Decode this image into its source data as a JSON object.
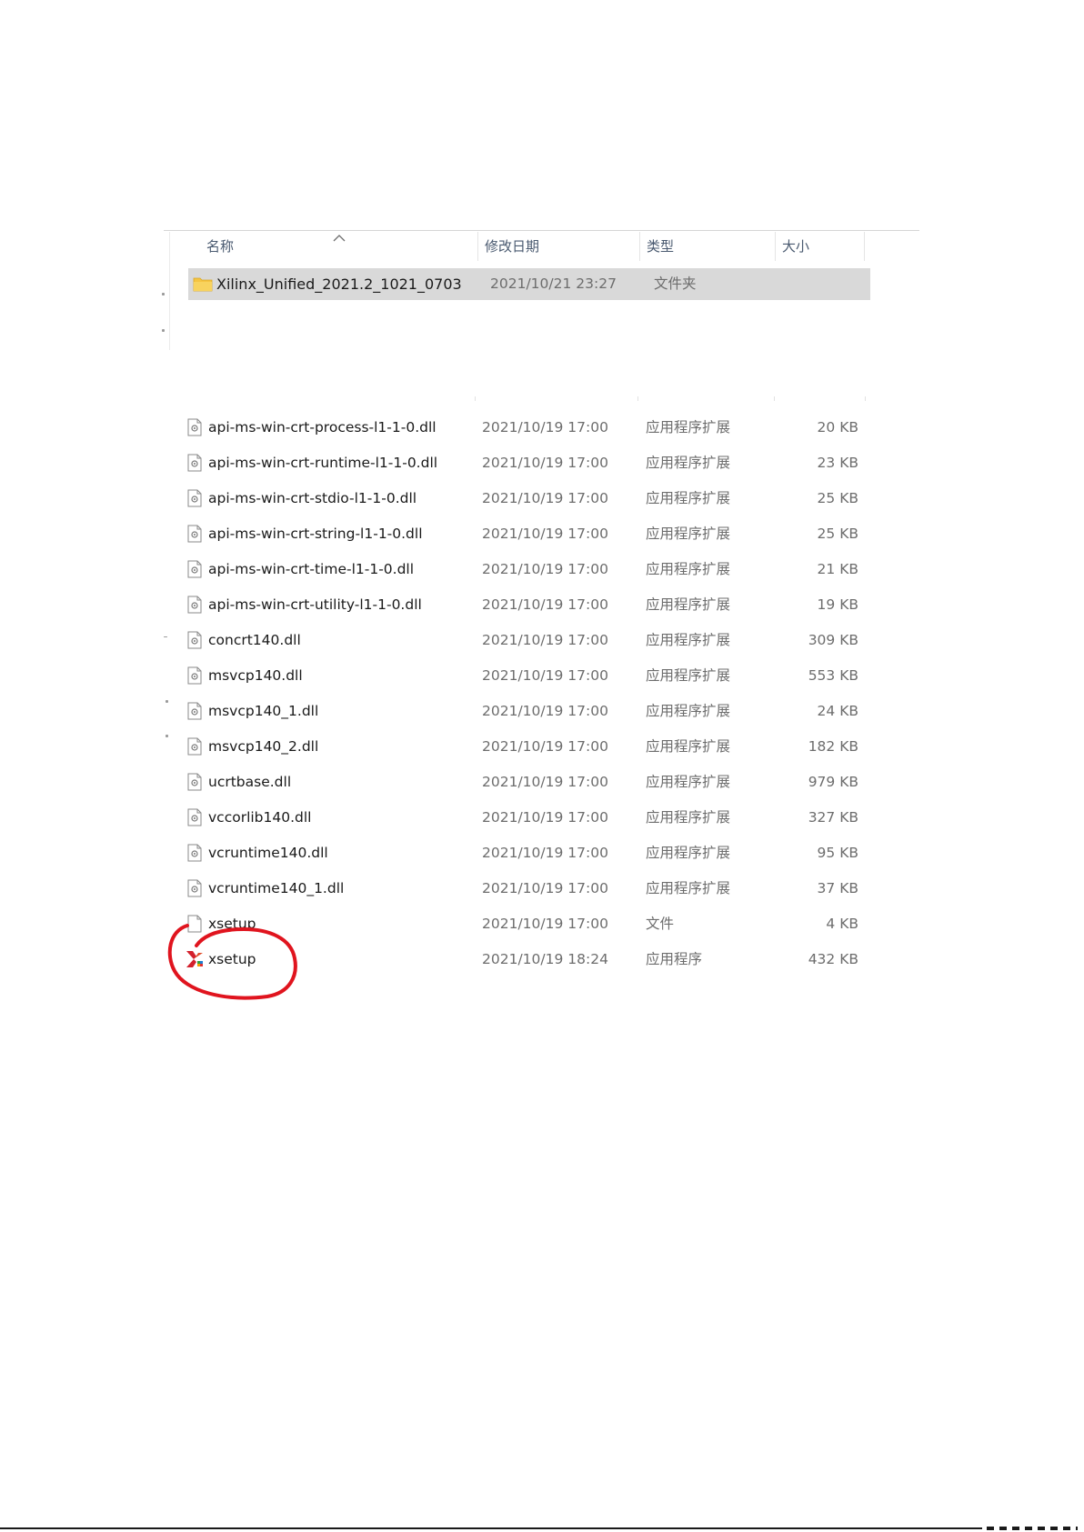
{
  "columns": {
    "name": "名称",
    "modified": "修改日期",
    "type": "类型",
    "size": "大小"
  },
  "folder": {
    "name": "Xilinx_Unified_2021.2_1021_0703",
    "modified": "2021/10/21 23:27",
    "type": "文件夹",
    "icon": "folder-icon"
  },
  "files": [
    {
      "name": "api-ms-win-crt-process-l1-1-0.dll",
      "modified": "2021/10/19 17:00",
      "type": "应用程序扩展",
      "size": "20 KB",
      "icon": "dll-file-icon"
    },
    {
      "name": "api-ms-win-crt-runtime-l1-1-0.dll",
      "modified": "2021/10/19 17:00",
      "type": "应用程序扩展",
      "size": "23 KB",
      "icon": "dll-file-icon"
    },
    {
      "name": "api-ms-win-crt-stdio-l1-1-0.dll",
      "modified": "2021/10/19 17:00",
      "type": "应用程序扩展",
      "size": "25 KB",
      "icon": "dll-file-icon"
    },
    {
      "name": "api-ms-win-crt-string-l1-1-0.dll",
      "modified": "2021/10/19 17:00",
      "type": "应用程序扩展",
      "size": "25 KB",
      "icon": "dll-file-icon"
    },
    {
      "name": "api-ms-win-crt-time-l1-1-0.dll",
      "modified": "2021/10/19 17:00",
      "type": "应用程序扩展",
      "size": "21 KB",
      "icon": "dll-file-icon"
    },
    {
      "name": "api-ms-win-crt-utility-l1-1-0.dll",
      "modified": "2021/10/19 17:00",
      "type": "应用程序扩展",
      "size": "19 KB",
      "icon": "dll-file-icon"
    },
    {
      "name": "concrt140.dll",
      "modified": "2021/10/19 17:00",
      "type": "应用程序扩展",
      "size": "309 KB",
      "icon": "dll-file-icon"
    },
    {
      "name": "msvcp140.dll",
      "modified": "2021/10/19 17:00",
      "type": "应用程序扩展",
      "size": "553 KB",
      "icon": "dll-file-icon"
    },
    {
      "name": "msvcp140_1.dll",
      "modified": "2021/10/19 17:00",
      "type": "应用程序扩展",
      "size": "24 KB",
      "icon": "dll-file-icon"
    },
    {
      "name": "msvcp140_2.dll",
      "modified": "2021/10/19 17:00",
      "type": "应用程序扩展",
      "size": "182 KB",
      "icon": "dll-file-icon"
    },
    {
      "name": "ucrtbase.dll",
      "modified": "2021/10/19 17:00",
      "type": "应用程序扩展",
      "size": "979 KB",
      "icon": "dll-file-icon"
    },
    {
      "name": "vccorlib140.dll",
      "modified": "2021/10/19 17:00",
      "type": "应用程序扩展",
      "size": "327 KB",
      "icon": "dll-file-icon"
    },
    {
      "name": "vcruntime140.dll",
      "modified": "2021/10/19 17:00",
      "type": "应用程序扩展",
      "size": "95 KB",
      "icon": "dll-file-icon"
    },
    {
      "name": "vcruntime140_1.dll",
      "modified": "2021/10/19 17:00",
      "type": "应用程序扩展",
      "size": "37 KB",
      "icon": "dll-file-icon"
    },
    {
      "name": "xsetup",
      "modified": "2021/10/19 17:00",
      "type": "文件",
      "size": "4 KB",
      "icon": "blank-file-icon"
    },
    {
      "name": "xsetup",
      "modified": "2021/10/19 18:24",
      "type": "应用程序",
      "size": "432 KB",
      "icon": "xilinx-app-icon"
    }
  ],
  "colors": {
    "selection": "#d9d9d9",
    "header_text": "#4a5a70",
    "meta_text": "#6d6d6d",
    "annotation": "#e0141e",
    "folder": "#f5c542"
  }
}
